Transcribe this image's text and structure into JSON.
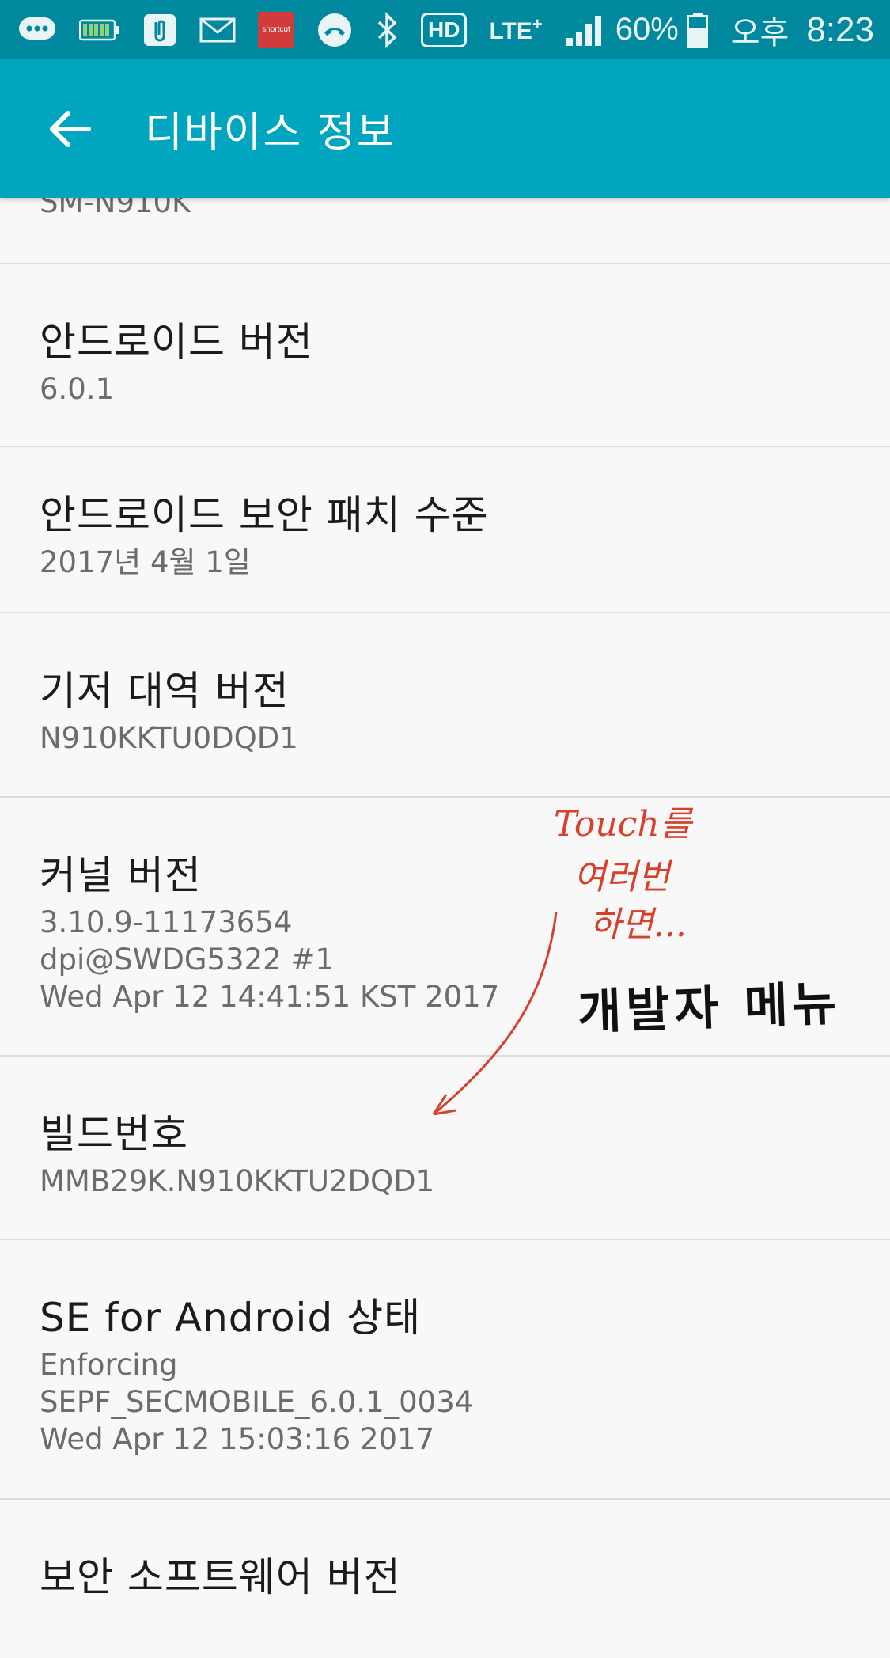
{
  "status_bar": {
    "shortcut_label": "shortcut",
    "hd_label": "HD",
    "lte_label": "LTE",
    "lte_plus": "+",
    "battery_percent": "60%",
    "ampm": "오후",
    "time": "8:23"
  },
  "app_bar": {
    "title": "디바이스 정보"
  },
  "items": [
    {
      "title": "",
      "lines": [
        "SM-N910K"
      ]
    },
    {
      "title": "안드로이드 버전",
      "lines": [
        "6.0.1"
      ]
    },
    {
      "title": "안드로이드 보안 패치 수준",
      "lines": [
        "2017년 4월 1일"
      ]
    },
    {
      "title": "기저 대역 버전",
      "lines": [
        "N910KKTU0DQD1"
      ]
    },
    {
      "title": "커널 버전",
      "lines": [
        "3.10.9-11173654",
        "dpi@SWDG5322 #1",
        "Wed Apr 12 14:41:51 KST 2017"
      ]
    },
    {
      "title": "빌드번호",
      "lines": [
        "MMB29K.N910KKTU2DQD1"
      ]
    },
    {
      "title": "SE for Android 상태",
      "lines": [
        "Enforcing",
        "SEPF_SECMOBILE_6.0.1_0034",
        "Wed Apr 12 15:03:16 2017"
      ]
    },
    {
      "title": "보안 소프트웨어 버전",
      "lines": []
    }
  ],
  "annotation": {
    "red_line1": "Touch를",
    "red_line2": "여러번",
    "red_line3": "하면...",
    "black_text": "개발자 메뉴"
  },
  "colors": {
    "status_bar": "#00899e",
    "app_bar": "#00a6c0",
    "background": "#f8f8f8",
    "annotation_red": "#d8402c"
  }
}
